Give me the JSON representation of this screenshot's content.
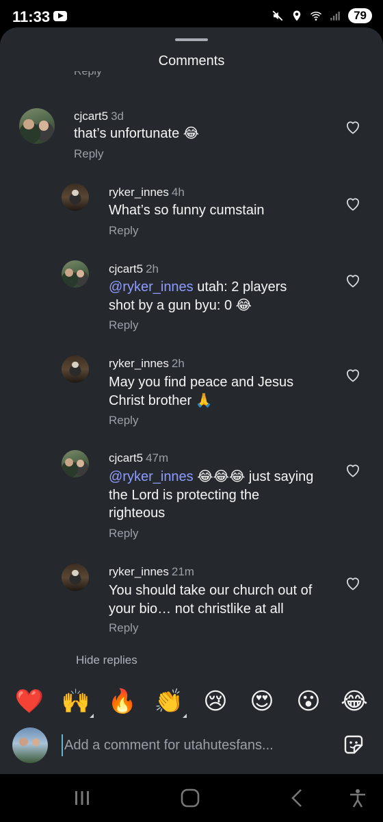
{
  "status": {
    "time": "11:33",
    "battery": "79"
  },
  "sheet": {
    "title": "Comments",
    "ghost_reply": "Reply"
  },
  "comments": [
    {
      "user": "cjcart5",
      "time": "3d",
      "text": "that’s unfortunate 😂",
      "reply": "Reply"
    },
    {
      "user": "ryker_innes",
      "time": "4h",
      "text": "What’s so funny cumstain",
      "reply": "Reply"
    },
    {
      "user": "cjcart5",
      "time": "2h",
      "mention": "@ryker_innes",
      "text": " utah: 2 players shot by a gun byu: 0 😂",
      "reply": "Reply"
    },
    {
      "user": "ryker_innes",
      "time": "2h",
      "text": "May you find peace and Jesus Christ brother 🙏",
      "reply": "Reply"
    },
    {
      "user": "cjcart5",
      "time": "47m",
      "mention": "@ryker_innes",
      "text": " 😂😂😂 just saying the Lord is protecting the righteous",
      "reply": "Reply"
    },
    {
      "user": "ryker_innes",
      "time": "21m",
      "text": "You should take our church out of your bio… not christlike at all",
      "reply": "Reply"
    }
  ],
  "hide_replies": "Hide replies",
  "quick_reactions": [
    "❤️",
    "🙌",
    "🔥",
    "👏",
    "😢",
    "😍",
    "😮",
    "😂"
  ],
  "input": {
    "placeholder": "Add a comment for utahutesfans..."
  },
  "icons": {
    "heart": "heart-outline-icon",
    "sticker": "sticker-icon"
  },
  "colors": {
    "sheet_bg": "#25292e",
    "mention": "#8f9cff",
    "muted": "#9aa0a6"
  }
}
